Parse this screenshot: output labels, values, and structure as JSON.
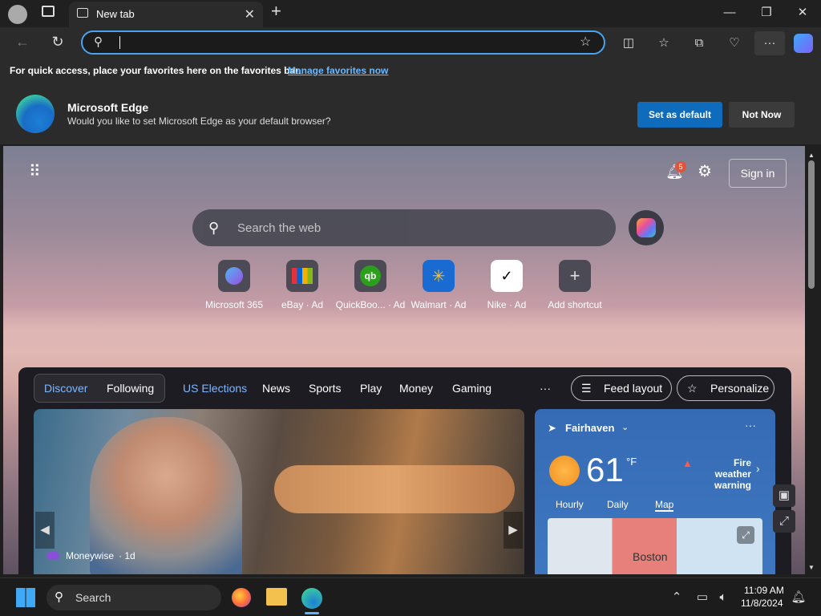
{
  "browser": {
    "tab_title": "New tab",
    "favorites_bar_text": "For quick access, place your favorites here on the favorites bar.",
    "favorites_bar_link": "Manage favorites now"
  },
  "promo": {
    "title": "Microsoft Edge",
    "subtitle": "Would you like to set Microsoft Edge as your default browser?",
    "primary_button": "Set as default",
    "secondary_button": "Not Now"
  },
  "ntp": {
    "sign_in": "Sign in",
    "notification_count": "5",
    "search_placeholder": "Search the web",
    "shortcuts": [
      {
        "label": "Microsoft 365"
      },
      {
        "label": "eBay · Ad"
      },
      {
        "label": "QuickBoo... · Ad"
      },
      {
        "label": "Walmart · Ad"
      },
      {
        "label": "Nike · Ad"
      },
      {
        "label": "Add shortcut"
      }
    ],
    "feed_tabs": [
      "Discover",
      "Following",
      "US Elections",
      "News",
      "Sports",
      "Play",
      "Money",
      "Gaming"
    ],
    "more": "···",
    "feed_layout": "Feed layout",
    "personalize": "Personalize",
    "hero_source": "Moneywise",
    "hero_age": "· 1d",
    "weather": {
      "location": "Fairhaven",
      "temperature": "61",
      "unit": "°F",
      "alert": "Fire weather warning",
      "tabs": [
        "Hourly",
        "Daily",
        "Map"
      ],
      "map_label": "Boston"
    }
  },
  "taskbar": {
    "search_label": "Search",
    "time": "11:09 AM",
    "date": "11/8/2024"
  }
}
